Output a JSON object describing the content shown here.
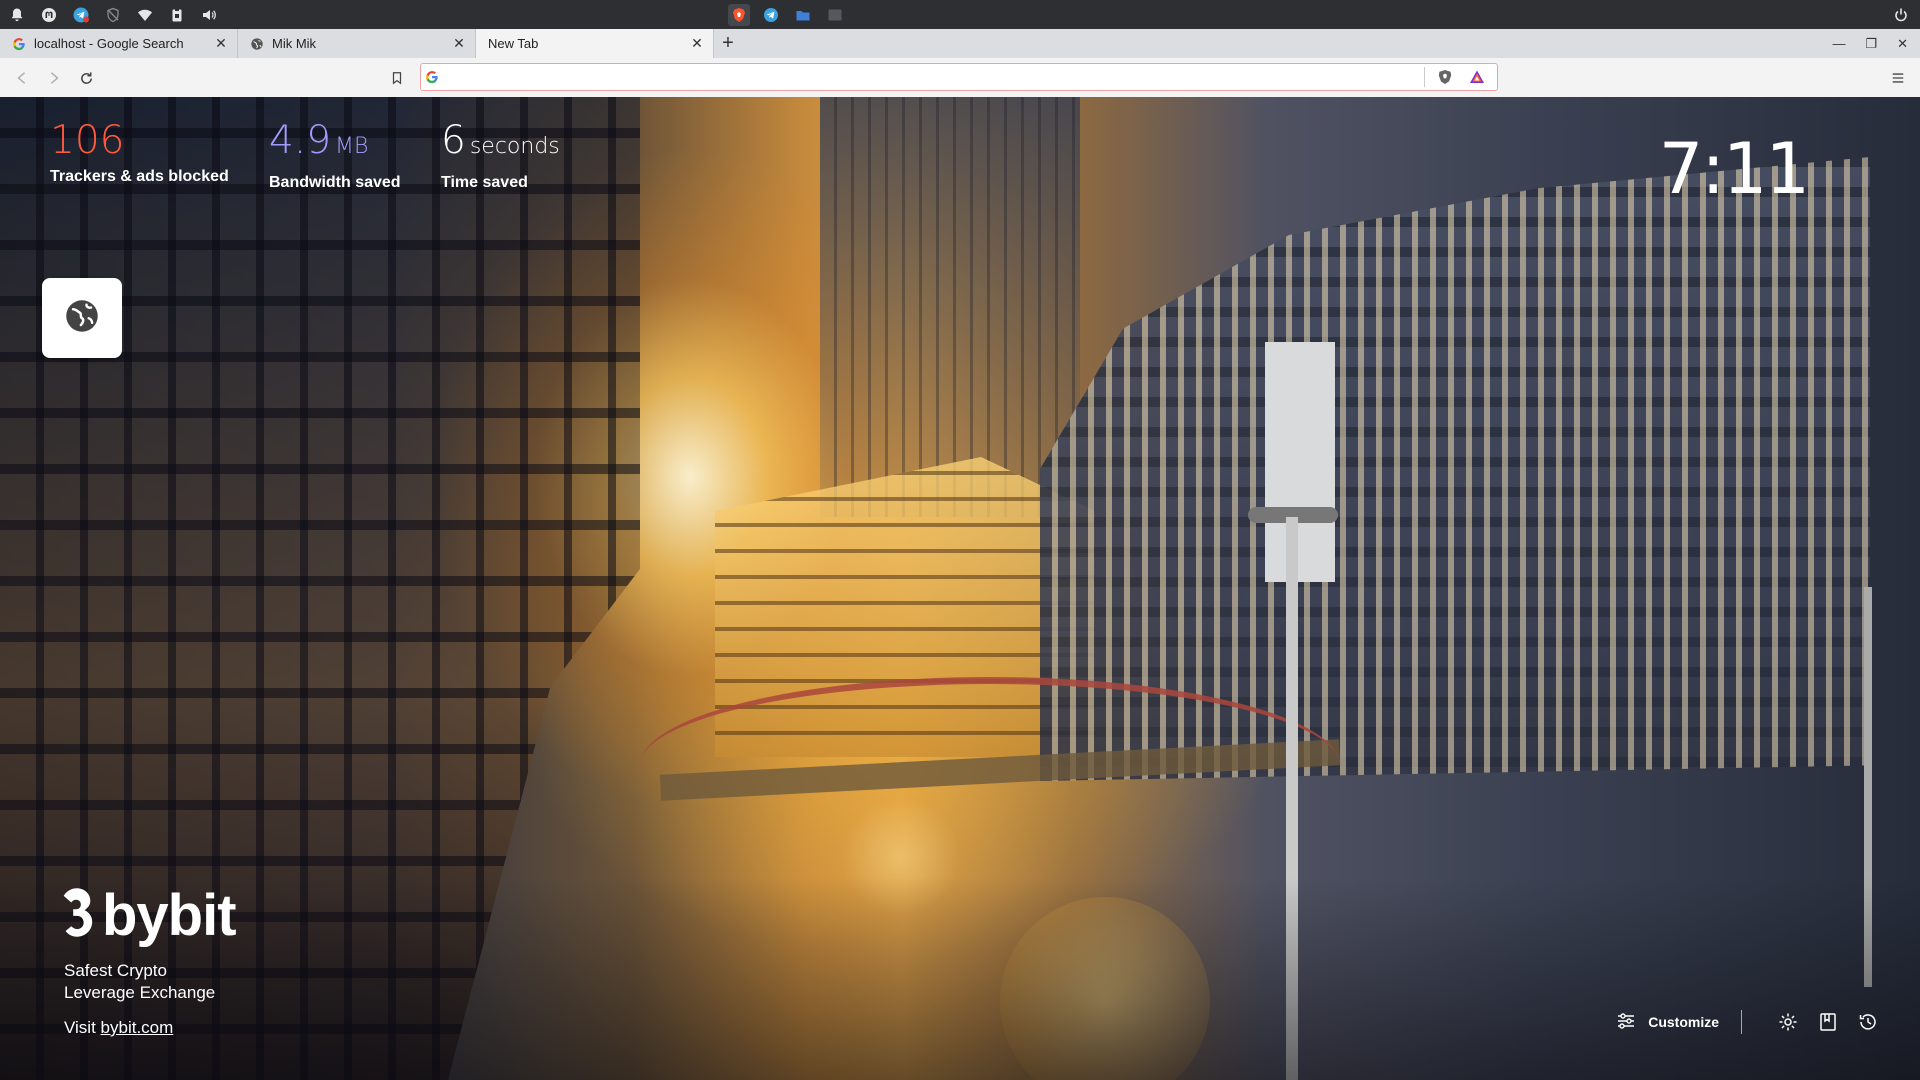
{
  "taskbar": {
    "tray_icons": [
      "bell-icon",
      "mastodon-icon",
      "telegram-icon",
      "shield-off-icon",
      "wifi-icon",
      "clipboard-icon",
      "volume-icon"
    ],
    "apps": [
      "brave-icon",
      "telegram-icon",
      "folder-icon",
      "terminal-icon"
    ],
    "right_icon": "power-icon"
  },
  "tabs": [
    {
      "title": "localhost - Google Search",
      "icon": "google-icon",
      "active": false
    },
    {
      "title": "Mik Mik",
      "icon": "globe-icon",
      "active": false
    },
    {
      "title": "New Tab",
      "icon": "",
      "active": true
    }
  ],
  "toolbar": {
    "address_value": "",
    "address_placeholder": "",
    "search_engine_icon": "google-icon"
  },
  "stats": {
    "trackers": {
      "value": "106",
      "label": "Trackers & ads blocked",
      "color": "#ff5a3c"
    },
    "bandwidth": {
      "value": "4.9",
      "unit": "MB",
      "label": "Bandwidth saved",
      "color": "#a59bff"
    },
    "time": {
      "value": "6",
      "unit": "seconds",
      "label": "Time saved",
      "color": "#ffffff"
    }
  },
  "clock": "7:11",
  "top_sites": [
    {
      "icon": "globe-icon"
    }
  ],
  "sponsored": {
    "brand": "bybit",
    "tagline_line1": "Safest Crypto",
    "tagline_line2": "Leverage Exchange",
    "visit_prefix": "Visit ",
    "visit_link": "bybit.com"
  },
  "controls": {
    "customize_label": "Customize",
    "icons": [
      "settings-icon",
      "bookmarks-icon",
      "history-icon"
    ]
  }
}
